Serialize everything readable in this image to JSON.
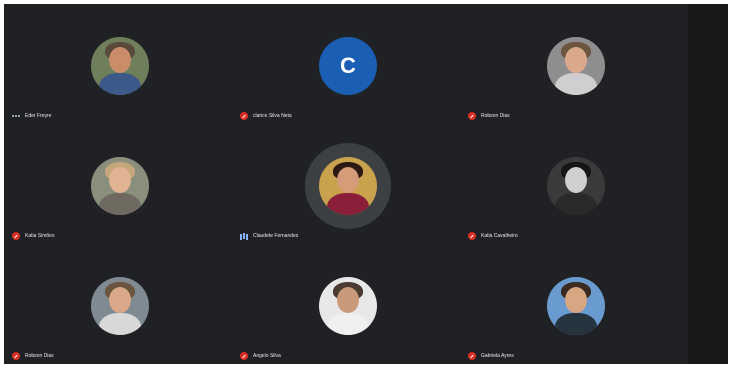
{
  "participants": [
    {
      "name": "Eder Freyre",
      "mic": "dots",
      "avatar": {
        "kind": "photo",
        "skin": "#c98d6a",
        "hair": "#5a4a3c",
        "body": "#3b5a8a",
        "bg": "#6f7f5b"
      }
    },
    {
      "name": "clarice Silva Neta",
      "mic": "muted",
      "avatar": {
        "kind": "letter",
        "letter": "C",
        "bg": "#1a5fb4"
      }
    },
    {
      "name": "Robson Dias",
      "mic": "muted",
      "avatar": {
        "kind": "photo",
        "skin": "#d9a98a",
        "hair": "#6b5440",
        "body": "#cfcfcf",
        "bg": "#8e8e8e"
      }
    },
    {
      "name": "Katia Simões",
      "mic": "muted",
      "avatar": {
        "kind": "photo",
        "skin": "#e0b493",
        "hair": "#c6a77a",
        "body": "#6e6a5f",
        "bg": "#8a8f7c"
      }
    },
    {
      "name": "Claudete Fernandes",
      "mic": "active",
      "speaking": true,
      "avatar": {
        "kind": "photo",
        "skin": "#d49c78",
        "hair": "#2a1a12",
        "body": "#8b1f3a",
        "bg": "#c9a24e"
      }
    },
    {
      "name": "Katia Cavalheiro",
      "mic": "muted",
      "avatar": {
        "kind": "photo",
        "skin": "#cfcfcf",
        "hair": "#151515",
        "body": "#2a2a2a",
        "bg": "#3a3a3a"
      }
    },
    {
      "name": "Robson Dias",
      "mic": "muted",
      "avatar": {
        "kind": "photo",
        "skin": "#d9a98a",
        "hair": "#6b5440",
        "body": "#d8d8d8",
        "bg": "#7f8a92"
      }
    },
    {
      "name": "Angelo Silva",
      "mic": "muted",
      "avatar": {
        "kind": "photo",
        "skin": "#c99a7a",
        "hair": "#4a3a30",
        "body": "#f0f0f0",
        "bg": "#e8e8e8"
      }
    },
    {
      "name": "Gabriela Ayres",
      "mic": "muted",
      "avatar": {
        "kind": "photo",
        "skin": "#d7a783",
        "hair": "#3a2a20",
        "body": "#26343f",
        "bg": "#6a9bd0"
      }
    }
  ]
}
